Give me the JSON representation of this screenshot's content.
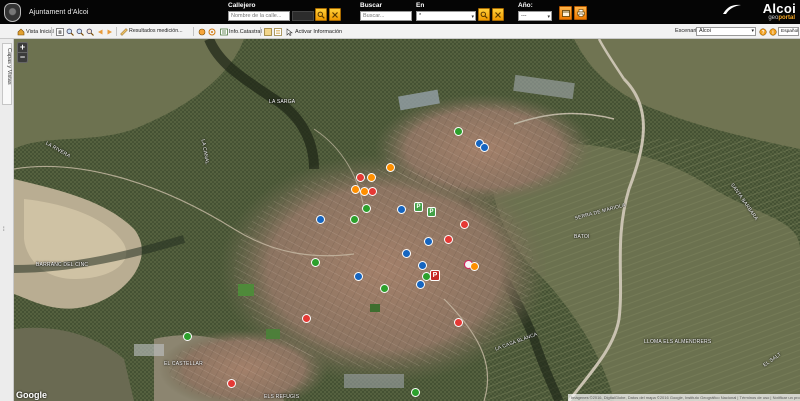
{
  "header": {
    "brand_title": "Ajuntament d'Alcoi",
    "callejero_label": "Callejero",
    "callejero_placeholder": "Nombre de la calle...",
    "buscar_label": "Buscar",
    "buscar_placeholder": "Buscar...",
    "en_label": "En",
    "en_value": "*",
    "anyo_label": "Año:",
    "anyo_value": "---",
    "logo_word": "Alcoi",
    "logo_sub_a": "geo",
    "logo_sub_b": "portal"
  },
  "toolbar": {
    "vista_inicial": "Vista Inicial",
    "resultados_medicion": "Resultados medición...",
    "info_catastral": "Info.Catastral",
    "activar_informacion": "Activar Información",
    "escenario_label": "Escenario:",
    "escenario_value": "Alcoi",
    "language_value": "Español"
  },
  "side": {
    "tab_label": "Capas y Vistas"
  },
  "map": {
    "zoom_in": "+",
    "zoom_out": "−",
    "google_logo": "Google",
    "attribution": "Imágenes ©2016, DigitalGlobe, Datos del mapa ©2016 Google, Instituto Geográfico Nacional | Términos de uso | Notificar un problema de Maps",
    "place_labels": [
      "ALCOI",
      "LA RIVERA",
      "BARRANC DEL CINC",
      "SERRA DE MARIOLA",
      "LA SARGA",
      "BATOI",
      "SANTA BARBARA",
      "EL CASTELLAR",
      "LA CANAL",
      "EL SALT",
      "LLOMA ELS ALMENDRERS",
      "LA CASA BLANCA",
      "ELS REFUGIS"
    ],
    "marker_types": [
      "green",
      "blue",
      "red",
      "orange",
      "parking",
      "park"
    ],
    "colors": {
      "header_bg": "#050505",
      "button_accent": "#f5a000",
      "map_base": "#4c5a3c",
      "urban": "#9d7a62"
    }
  }
}
